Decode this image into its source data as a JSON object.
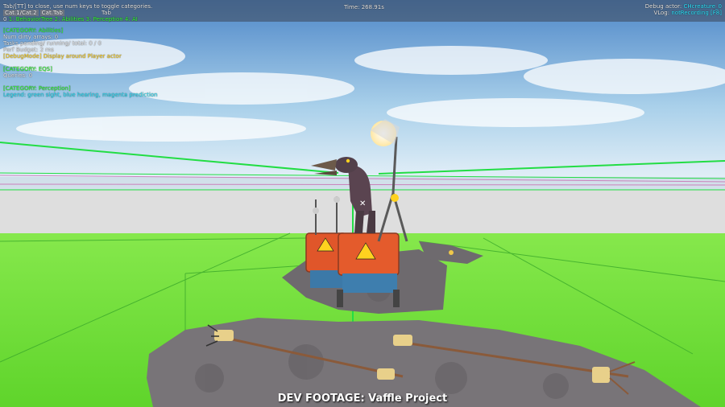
{
  "hud": {
    "hint": "Tab/[TT] to close, use num keys to toggle categories.",
    "tab_label": "Tab",
    "time": "Time: 268.91s",
    "debug_actor_label": "Debug actor:",
    "debug_actor_value": "CHcreature_0",
    "vlog_label": "VLog:",
    "vlog_value": "notRecording [F8]",
    "chips": [
      "Cat.1/Cat.2",
      "Cat.Tab"
    ],
    "categories_row": [
      {
        "text": "0",
        "cls": "wht"
      },
      {
        "text": "1: BehaviorTree",
        "cls": "cat"
      },
      {
        "text": "2: Abilities",
        "cls": "cat"
      },
      {
        "text": "3: Perception",
        "cls": "cat"
      },
      {
        "text": "4: AI",
        "cls": "cat"
      }
    ],
    "lines": [
      {
        "text": "[CATEGORY: Abilities]",
        "cls": "cat"
      },
      {
        "text": "Num dirty arrays: 0",
        "cls": "wht"
      },
      {
        "text": "Tasks pending/ running/ total: 0 / 0",
        "cls": "wht"
      },
      {
        "text": "Perf Budget: 2 ms",
        "cls": "wht"
      },
      {
        "text": "[DebugMode] Display around Player actor",
        "cls": "yel"
      },
      {
        "text": "",
        "cls": "wht"
      },
      {
        "text": "[CATEGORY: EQS]",
        "cls": "cat"
      },
      {
        "text": "Queries: 0",
        "cls": "wht"
      },
      {
        "text": "",
        "cls": "wht"
      },
      {
        "text": "[CATEGORY: Perception]",
        "cls": "cat"
      },
      {
        "text": "Legend: green sight, blue hearing, magenta prediction",
        "cls": "cyan"
      }
    ]
  },
  "footer": {
    "text": "DEV FOOTAGE: Vaffle Project"
  },
  "colors": {
    "ground": "#71e33a",
    "sky_top": "#4f86c6",
    "sky_bottom": "#e8f2f8",
    "wall": "#dcdcdc",
    "debug_line": "#28e048"
  }
}
